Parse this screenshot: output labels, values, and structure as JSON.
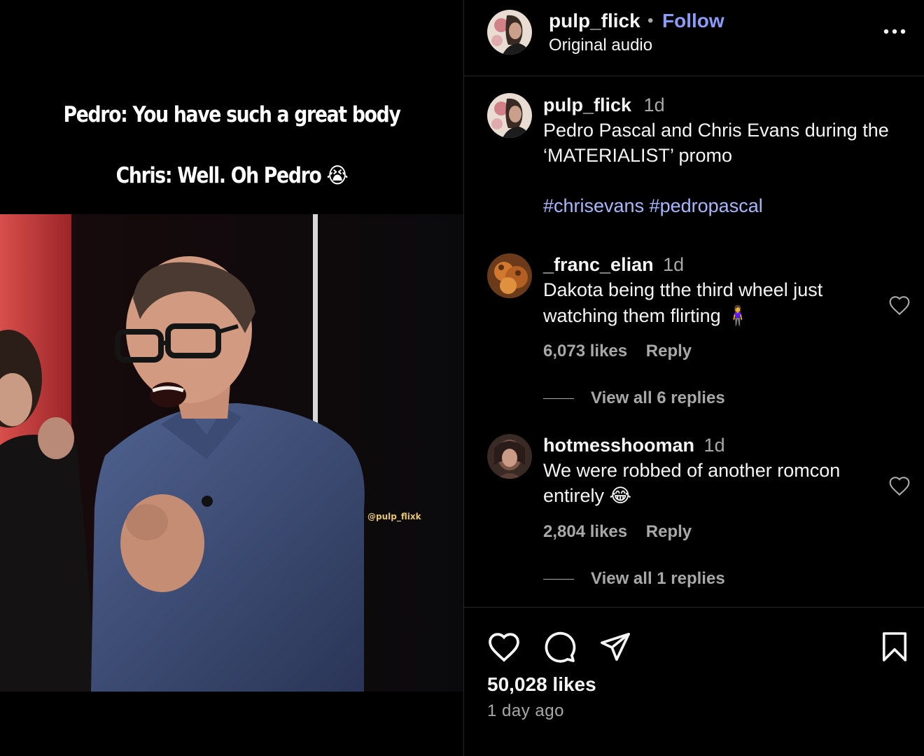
{
  "video": {
    "caption_line_1": "Pedro: You have such a great body",
    "caption_line_2": "Chris: Well. Oh Pedro 😭",
    "watermark": "@pulp_flixk"
  },
  "header": {
    "username": "pulp_flick",
    "separator": "•",
    "follow_label": "Follow",
    "audio": "Original audio",
    "more_icon": "more-horizontal-icon"
  },
  "post": {
    "username": "pulp_flick",
    "time": "1d",
    "caption_line_1": "Pedro Pascal and Chris Evans during the",
    "caption_line_2": "‘MATERIALIST’ promo",
    "hashtag_1": "#chrisevans",
    "hashtag_2": "#pedropascal"
  },
  "comments": [
    {
      "username": "_franc_elian",
      "time": "1d",
      "text_line_1": "Dakota being tthe third wheel just",
      "text_line_2": "watching them flirting 🧍‍♀️",
      "likes": "6,073 likes",
      "reply_label": "Reply",
      "view_replies": "View all 6 replies"
    },
    {
      "username": "hotmesshooman",
      "time": "1d",
      "text_line_1": "We were robbed of another romcon",
      "text_line_2": "entirely 😂",
      "likes": "2,804 likes",
      "reply_label": "Reply",
      "view_replies": "View all 1 replies"
    }
  ],
  "actions": {
    "icons": [
      "heart-icon",
      "comment-icon",
      "share-icon",
      "bookmark-icon"
    ],
    "likes": "50,028 likes",
    "posted": "1 day ago"
  },
  "colors": {
    "background": "#000000",
    "follow": "#8b9bf8",
    "hashtag": "#a7b7ff",
    "secondary_text": "#a8a8a8",
    "divider": "#262626"
  }
}
